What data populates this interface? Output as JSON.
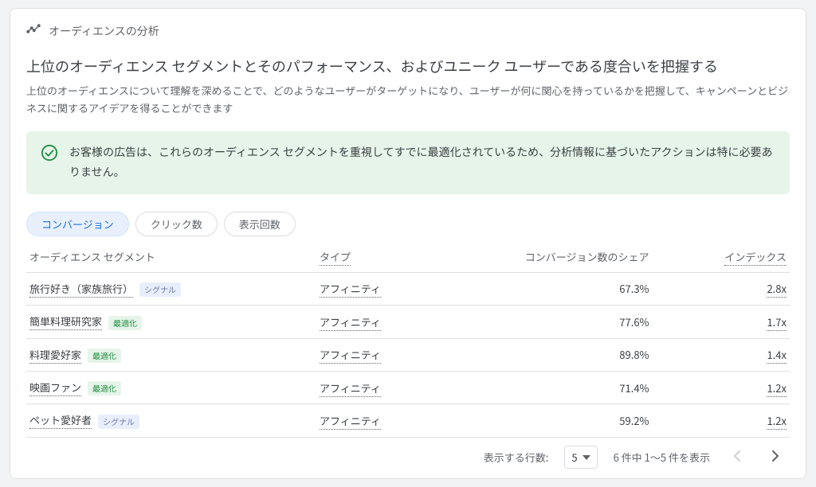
{
  "header": {
    "icon_name": "trend-icon",
    "title": "オーディエンスの分析"
  },
  "headline": "上位のオーディエンス セグメントとそのパフォーマンス、およびユニーク ユーザーである度合いを把握する",
  "description": "上位のオーディエンスについて理解を深めることで、どのようなユーザーがターゲットになり、ユーザーが何に関心を持っているかを把握して、キャンペーンとビジネスに関するアイデアを得ることができます",
  "banner": {
    "icon_name": "check-circle-icon",
    "text": "お客様の広告は、これらのオーディエンス セグメントを重視してすでに最適化されているため、分析情報に基づいたアクションは特に必要ありません。"
  },
  "tabs": [
    {
      "label": "コンバージョン",
      "active": true
    },
    {
      "label": "クリック数",
      "active": false
    },
    {
      "label": "表示回数",
      "active": false
    }
  ],
  "columns": {
    "segment": "オーディエンス セグメント",
    "type": "タイプ",
    "share": "コンバージョン数のシェア",
    "index": "インデックス"
  },
  "badge_labels": {
    "signal": "シグナル",
    "opt": "最適化"
  },
  "type_label": "アフィニティ",
  "rows": [
    {
      "segment": "旅行好き（家族旅行）",
      "badge": "signal",
      "share": "67.3%",
      "index": "2.8x"
    },
    {
      "segment": "簡単料理研究家",
      "badge": "opt",
      "share": "77.6%",
      "index": "1.7x"
    },
    {
      "segment": "料理愛好家",
      "badge": "opt",
      "share": "89.8%",
      "index": "1.4x"
    },
    {
      "segment": "映画ファン",
      "badge": "opt",
      "share": "71.4%",
      "index": "1.2x"
    },
    {
      "segment": "ペット愛好者",
      "badge": "signal",
      "share": "59.2%",
      "index": "1.2x"
    }
  ],
  "footer": {
    "rows_label": "表示する行数:",
    "rows_value": "5",
    "range_label": "6 件中 1～5 件を表示"
  }
}
